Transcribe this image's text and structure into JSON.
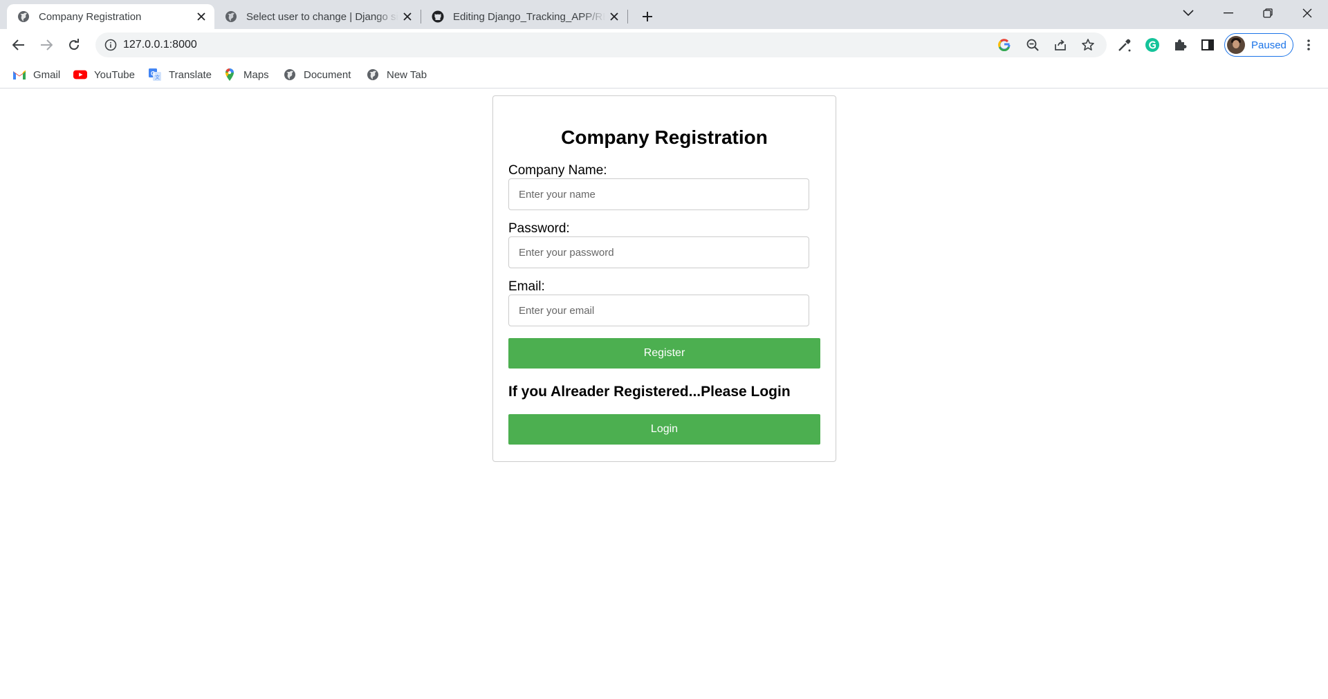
{
  "browser": {
    "tabs": [
      {
        "title": "Company Registration",
        "icon": "globe-icon",
        "active": true
      },
      {
        "title": "Select user to change | Django site admin",
        "icon": "globe-icon",
        "active": false
      },
      {
        "title": "Editing Django_Tracking_APP/README.md",
        "icon": "github-icon",
        "active": false
      }
    ],
    "address": {
      "url": "127.0.0.1:8000"
    },
    "profile": {
      "label": "Paused"
    },
    "colors": {
      "tabstrip": "#dee1e6",
      "accent": "#1a73e8"
    }
  },
  "bookmarks": [
    {
      "label": "Gmail",
      "icon": "gmail-icon"
    },
    {
      "label": "YouTube",
      "icon": "youtube-icon"
    },
    {
      "label": "Translate",
      "icon": "translate-icon"
    },
    {
      "label": "Maps",
      "icon": "maps-icon"
    },
    {
      "label": "Document",
      "icon": "globe-icon"
    },
    {
      "label": "New Tab",
      "icon": "globe-icon"
    }
  ],
  "form": {
    "title": "Company Registration",
    "company_name": {
      "label": "Company Name:",
      "placeholder": "Enter your name",
      "value": ""
    },
    "password": {
      "label": "Password:",
      "placeholder": "Enter your password",
      "value": ""
    },
    "email": {
      "label": "Email:",
      "placeholder": "Enter your email",
      "value": ""
    },
    "register_label": "Register",
    "login_hint": "If you Alreader Registered...Please Login",
    "login_label": "Login",
    "button_color": "#4caf50"
  }
}
